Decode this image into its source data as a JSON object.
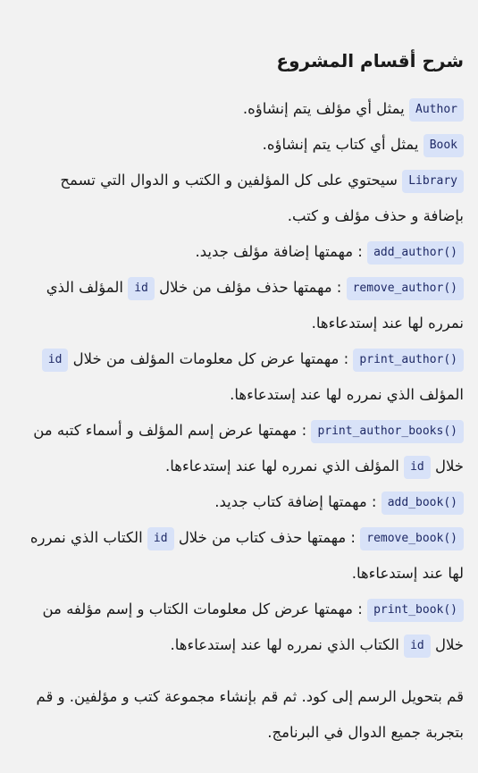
{
  "title": "شرح أقسام المشروع",
  "items": [
    {
      "code": "Author",
      "text": " يمثل أي مؤلف يتم إنشاؤه."
    },
    {
      "code": "Book",
      "text": " يمثل أي كتاب يتم إنشاؤه."
    },
    {
      "code": "Library",
      "text": " سيحتوي على كل المؤلفين و الكتب و الدوال التي تسمح بإضافة و حذف مؤلف و كتب."
    },
    {
      "code": "add_author()",
      "text": " : مهمتها إضافة مؤلف جديد."
    },
    {
      "code": "remove_author()",
      "text": " : مهمتها حذف مؤلف من خلال ",
      "code2": "id",
      "text2": " المؤلف الذي نمرره لها عند إستدعاءها."
    },
    {
      "code": "print_author()",
      "text": " : مهمتها عرض كل معلومات المؤلف من خلال ",
      "code2": "id",
      "text2": " المؤلف الذي نمرره لها عند إستدعاءها."
    },
    {
      "code": "print_author_books()",
      "text": " : مهمتها عرض إسم المؤلف و أسماء كتبه من خلال ",
      "code2": "id",
      "text2": " المؤلف الذي نمرره لها عند إستدعاءها."
    },
    {
      "code": "add_book()",
      "text": " : مهمتها إضافة كتاب جديد."
    },
    {
      "code": "remove_book()",
      "text": " : مهمتها حذف كتاب من خلال ",
      "code2": "id",
      "text2": " الكتاب الذي نمرره لها عند إستدعاءها."
    },
    {
      "code": "print_book()",
      "text": " : مهمتها عرض كل معلومات الكتاب و إسم مؤلفه من خلال ",
      "code2": "id",
      "text2": " الكتاب الذي نمرره لها عند إستدعاءها."
    }
  ],
  "closing": "قم بتحويل الرسم إلى كود. ثم قم بإنشاء مجموعة كتب و مؤلفين. و قم بتجربة جميع الدوال في البرنامج."
}
